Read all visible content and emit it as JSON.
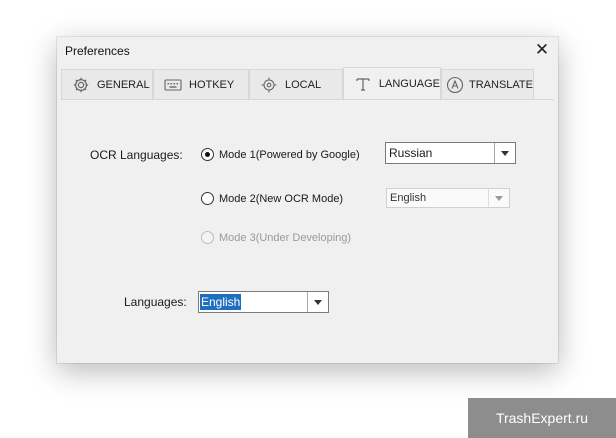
{
  "window": {
    "title": "Preferences",
    "close_glyph": "✕"
  },
  "tabs": [
    {
      "label": "GENERAL",
      "icon": "gear-icon",
      "active": false
    },
    {
      "label": "HOTKEY",
      "icon": "keyboard-icon",
      "active": false
    },
    {
      "label": "LOCAL",
      "icon": "target-icon",
      "active": false
    },
    {
      "label": "LANGUAGE",
      "icon": "text-t-icon",
      "active": true
    },
    {
      "label": "TRANSLATE",
      "icon": "translate-a-icon",
      "active": false
    }
  ],
  "ocr": {
    "label": "OCR Languages:",
    "modes": [
      {
        "label": "Mode 1(Powered by Google)",
        "selected": true,
        "enabled": true,
        "language": "Russian"
      },
      {
        "label": "Mode 2(New OCR Mode)",
        "selected": false,
        "enabled": true,
        "language": "English"
      },
      {
        "label": "Mode 3(Under Developing)",
        "selected": false,
        "enabled": false
      }
    ]
  },
  "languages": {
    "label": "Languages:",
    "value": "English"
  },
  "watermark": "TrashExpert.ru"
}
